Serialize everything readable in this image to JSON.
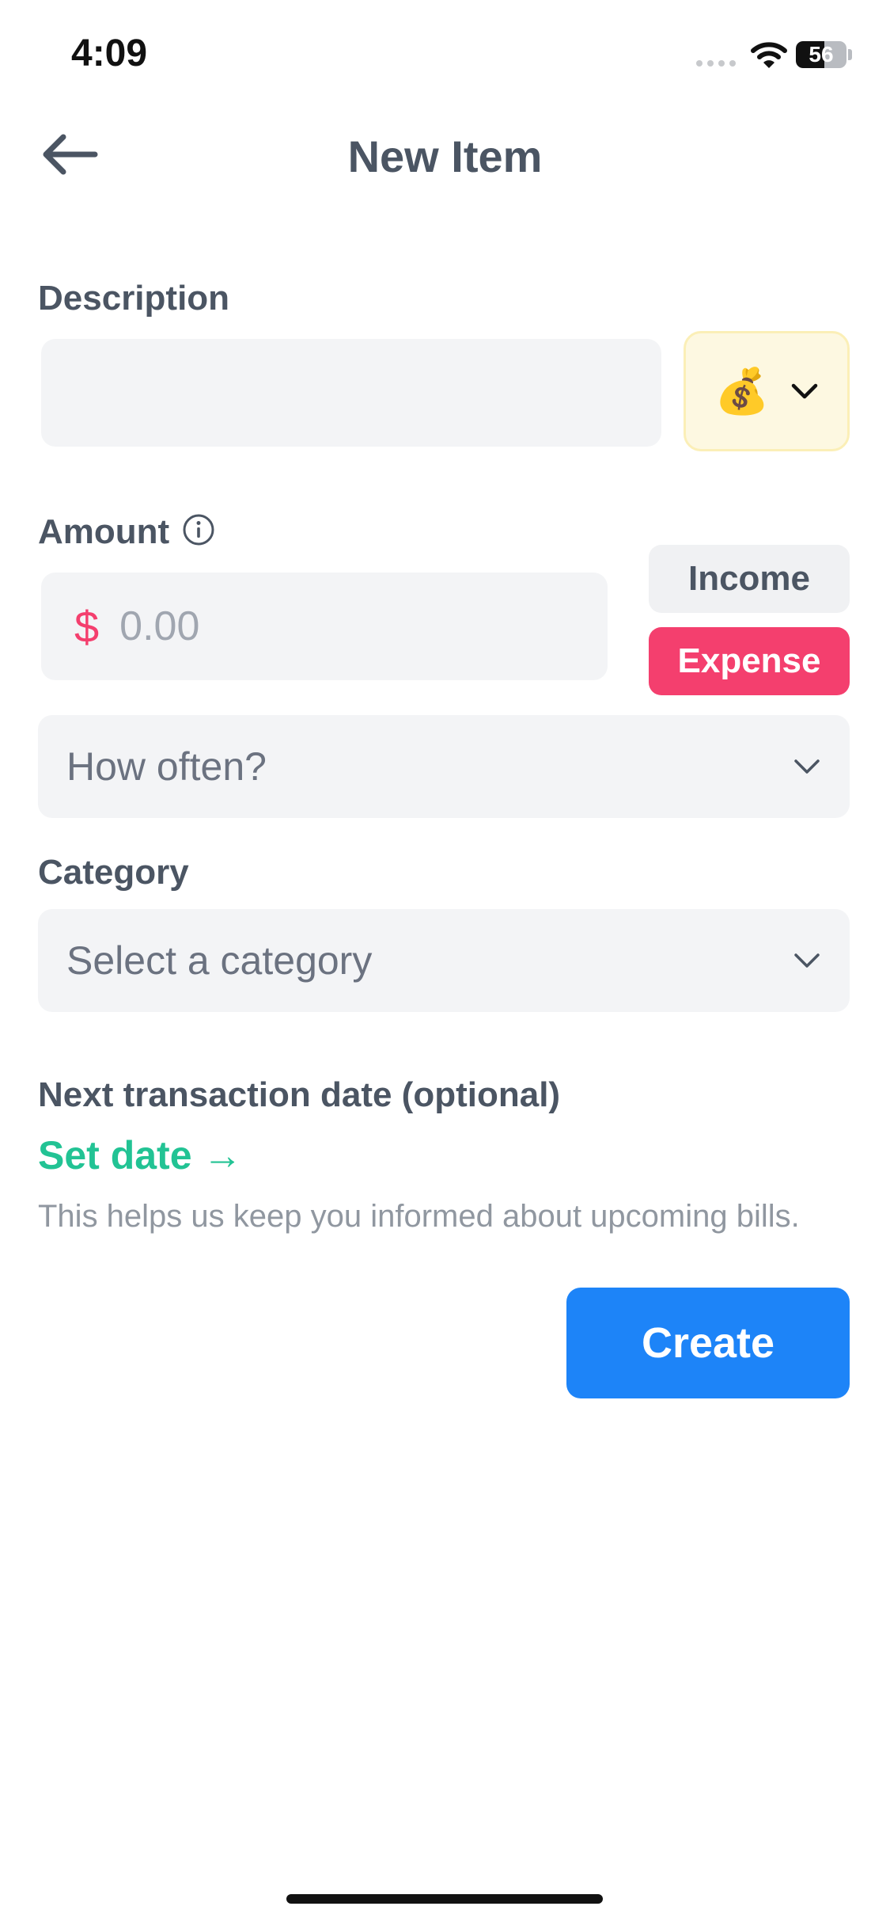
{
  "status_bar": {
    "time": "4:09",
    "battery_level": "56",
    "battery_fill_fraction": 0.56
  },
  "header": {
    "title": "New Item",
    "back_icon": "arrow-left-icon"
  },
  "description": {
    "label": "Description",
    "value": "",
    "emoji": "💰",
    "chevron_icon": "chevron-down-icon"
  },
  "amount": {
    "label": "Amount",
    "info_icon": "info-icon",
    "currency_symbol": "$",
    "placeholder": "0.00",
    "type_options": [
      "Income",
      "Expense"
    ],
    "income_label": "Income",
    "expense_label": "Expense",
    "selected_type": "Expense"
  },
  "frequency": {
    "placeholder": "How often?"
  },
  "category": {
    "label": "Category",
    "placeholder": "Select a category"
  },
  "next_date": {
    "label": "Next transaction date (optional)",
    "link_label": "Set date",
    "link_arrow": "→",
    "helper_text": "This helps us keep you informed about upcoming bills."
  },
  "actions": {
    "create_label": "Create"
  },
  "colors": {
    "accent_blue": "#1d84f8",
    "expense_pink": "#f43f6e",
    "link_green": "#22c394",
    "field_gray": "#f3f4f6"
  }
}
